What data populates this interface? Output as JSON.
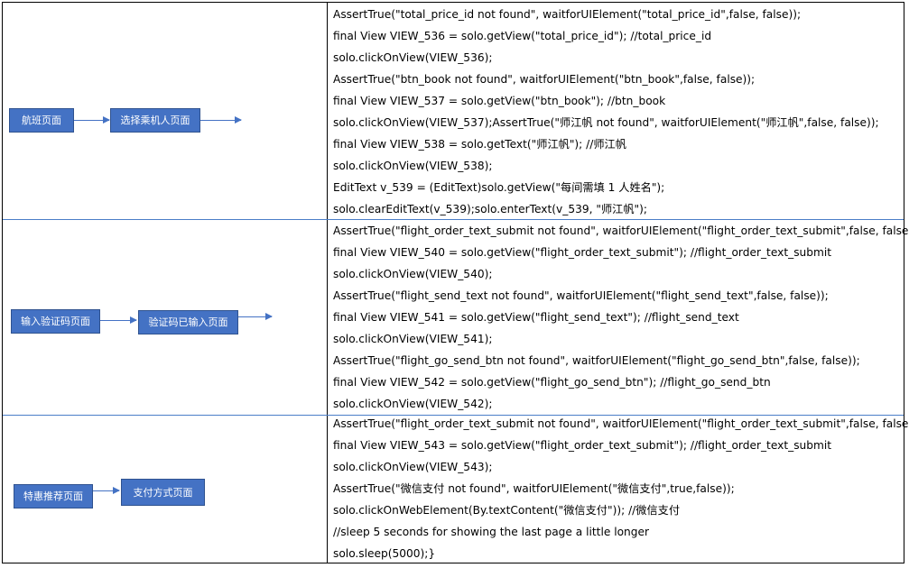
{
  "sections": [
    {
      "boxes": [
        "航班页面",
        "选择乘机人页面"
      ],
      "code": [
        "AssertTrue(\"total_price_id not found\", waitforUIElement(\"total_price_id\",false, false));",
        "final View VIEW_536 = solo.getView(\"total_price_id\"); //total_price_id",
        "solo.clickOnView(VIEW_536);",
        "AssertTrue(\"btn_book not found\", waitforUIElement(\"btn_book\",false, false));",
        "final View VIEW_537 = solo.getView(\"btn_book\"); //btn_book",
        "solo.clickOnView(VIEW_537);AssertTrue(\"师江帆  not found\", waitforUIElement(\"师江帆\",false, false));",
        "final View VIEW_538 = solo.getText(\"师江帆\"); //师江帆",
        "solo.clickOnView(VIEW_538);",
        "EditText v_539 = (EditText)solo.getView(\"每间需填 1 人姓名\");",
        "solo.clearEditText(v_539);solo.enterText(v_539, \"师江帆\");"
      ]
    },
    {
      "boxes": [
        "输入验证码页面",
        "验证码已输入页面"
      ],
      "code": [
        "AssertTrue(\"flight_order_text_submit not found\", waitforUIElement(\"flight_order_text_submit\",false, false));",
        "final View VIEW_540 = solo.getView(\"flight_order_text_submit\"); //flight_order_text_submit",
        "solo.clickOnView(VIEW_540);",
        "AssertTrue(\"flight_send_text not found\", waitforUIElement(\"flight_send_text\",false, false));",
        "final View VIEW_541 = solo.getView(\"flight_send_text\"); //flight_send_text",
        "solo.clickOnView(VIEW_541);",
        "AssertTrue(\"flight_go_send_btn not found\", waitforUIElement(\"flight_go_send_btn\",false, false));",
        "final View VIEW_542 = solo.getView(\"flight_go_send_btn\"); //flight_go_send_btn",
        "solo.clickOnView(VIEW_542);"
      ]
    },
    {
      "boxes": [
        "特惠推荐页面",
        "支付方式页面"
      ],
      "code": [
        "AssertTrue(\"flight_order_text_submit not found\", waitforUIElement(\"flight_order_text_submit\",false, false));",
        "final View VIEW_543 = solo.getView(\"flight_order_text_submit\"); //flight_order_text_submit",
        "solo.clickOnView(VIEW_543);",
        "AssertTrue(\"微信支付  not found\", waitforUIElement(\"微信支付\",true,false));",
        "solo.clickOnWebElement(By.textContent(\"微信支付\")); //微信支付",
        "//sleep 5 seconds for showing the last page a little longer",
        "solo.sleep(5000);}"
      ]
    }
  ],
  "colors": {
    "box_fill": "#4472c4",
    "box_border": "#2f528f",
    "row_divider": "#4a7ec8"
  }
}
